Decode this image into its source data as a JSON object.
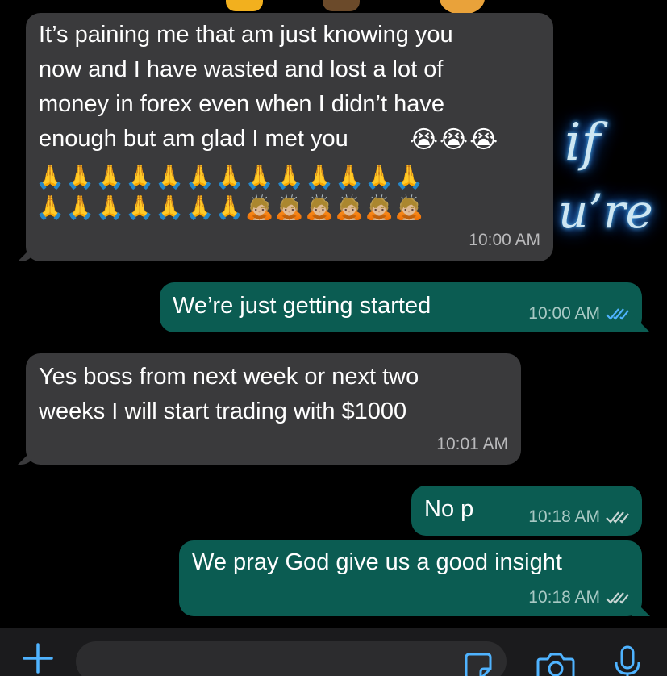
{
  "messages": [
    {
      "direction": "incoming",
      "lines": [
        "It’s paining me that am just knowing you",
        "now and I have wasted and lost a lot of",
        "money in forex even when I didn’t have",
        "enough but am glad I met you"
      ],
      "emoji_inline": "😭😭😭",
      "emoji_line_1": "🙏🙏🙏🙏🙏🙏🙏🙏🙏🙏🙏🙏🙏",
      "emoji_line_2": "🙏🙏🙏🙏🙏🙏🙏🙇🏼🙇🏼🙇🏼🙇🏼🙇🏼🙇🏼",
      "time": "10:00 AM"
    },
    {
      "direction": "outgoing",
      "text": "We’re just getting started",
      "time": "10:00 AM",
      "read": true
    },
    {
      "direction": "incoming",
      "lines": [
        "Yes boss from next week or next two",
        "weeks I will start trading with $1000"
      ],
      "time": "10:01 AM"
    },
    {
      "direction": "outgoing",
      "text": "No p",
      "time": "10:18 AM",
      "read": false
    },
    {
      "direction": "outgoing",
      "text": "We pray God give us a good insight",
      "time": "10:18 AM",
      "read": false
    }
  ],
  "wallpaper": {
    "word_if": "if",
    "word_re": "u’re",
    "accent_glow": "#2f8cff"
  },
  "icons": {
    "attach": "plus-icon",
    "sticker": "sticker-icon",
    "camera": "camera-icon",
    "mic": "microphone-icon"
  },
  "colors": {
    "incoming_bubble": "#3a3a3c",
    "outgoing_bubble": "#0b5c52",
    "read_ticks": "#4fb3ff",
    "sent_ticks": "#c9d6d4"
  }
}
